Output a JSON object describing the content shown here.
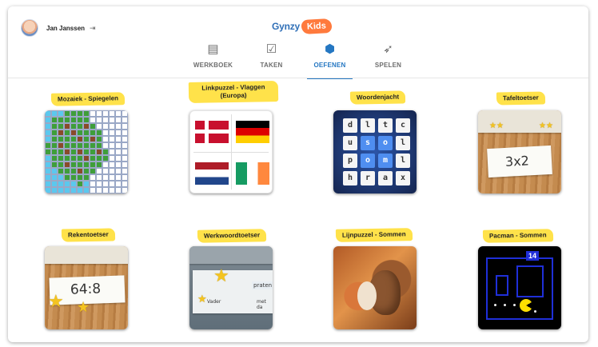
{
  "user": {
    "name": "Jan Janssen",
    "logout_icon": "logout-icon"
  },
  "logo": {
    "text": "Gynzy",
    "kids": "Kids",
    "kids_color": "#ff7a3d"
  },
  "tabs": [
    {
      "label": "WERKBOEK",
      "icon": "book-icon",
      "glyph": "📓"
    },
    {
      "label": "TAKEN",
      "icon": "tasks-icon",
      "glyph": "✅"
    },
    {
      "label": "OEFENEN",
      "icon": "cube-icon",
      "glyph": "⬢",
      "active": true
    },
    {
      "label": "SPELEN",
      "icon": "rocket-icon",
      "glyph": "🚀"
    }
  ],
  "accent_color": "#2577c2",
  "label_color": "#ffe24a",
  "games": [
    {
      "label": "Mozaiek - Spiegelen"
    },
    {
      "label": "Linkpuzzel - Vlaggen (Europa)"
    },
    {
      "label": "Woordenjacht"
    },
    {
      "label": "Tafeltoetser"
    },
    {
      "label": "Rekentoetser"
    },
    {
      "label": "Werkwoordtoetser"
    },
    {
      "label": "Lijnpuzzel - Sommen"
    },
    {
      "label": "Pacman - Sommen"
    }
  ],
  "thumbs": {
    "woordenjacht_letters": [
      "d",
      "l",
      "t",
      "c",
      "u",
      "s",
      "o",
      "l",
      "p",
      "o",
      "m",
      "l",
      "h",
      "r",
      "a",
      "x"
    ],
    "tafeltoetser_text": "3x2",
    "rekentoetser_text": "64:8",
    "werkwoord_word": "praten",
    "werkwoord_line_start": "Vader",
    "werkwoord_line_mid": "met da",
    "pacman_number": "14"
  }
}
